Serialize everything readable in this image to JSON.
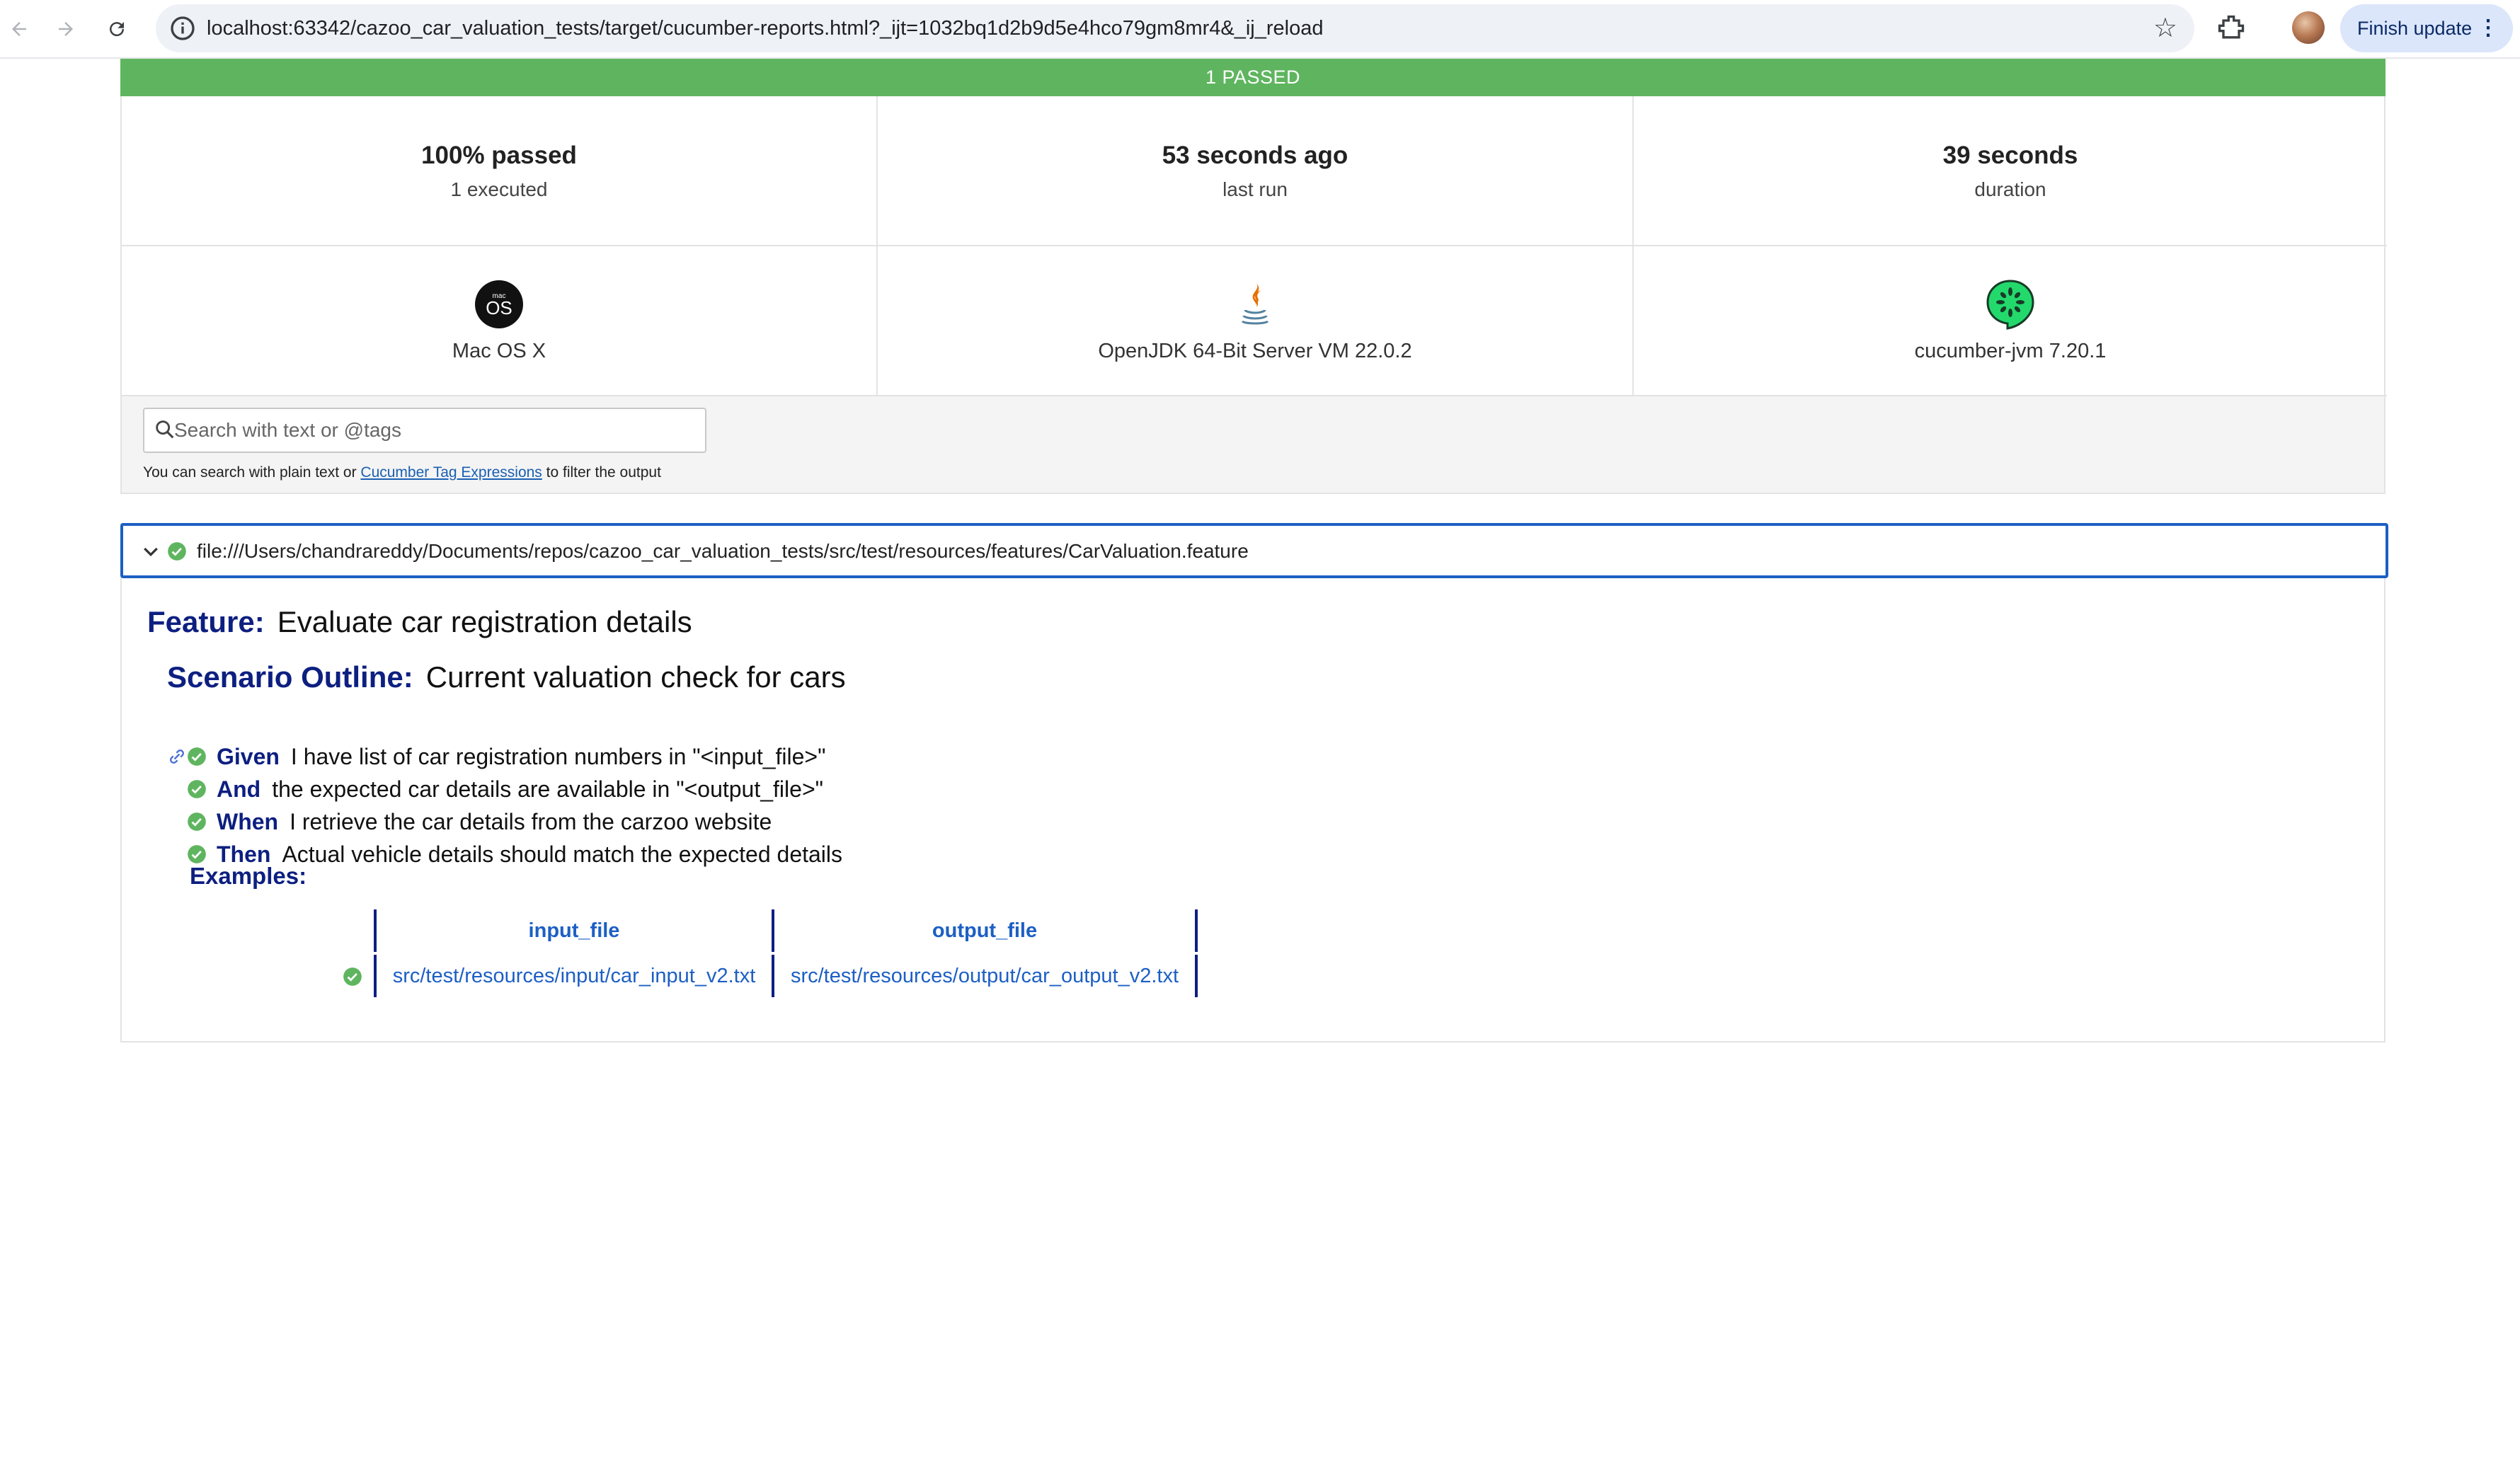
{
  "browser": {
    "url": "localhost:63342/cazoo_car_valuation_tests/target/cucumber-reports.html?_ijt=1032bq1d2b9d5e4hco79gm8mr4&_ij_reload",
    "finish_update_label": "Finish update"
  },
  "summary": {
    "banner": "1 PASSED",
    "stats": [
      {
        "main": "100% passed",
        "sub": "1 executed"
      },
      {
        "main": "53 seconds ago",
        "sub": "last run"
      },
      {
        "main": "39 seconds",
        "sub": "duration"
      }
    ],
    "environment": [
      {
        "icon": "macos-icon",
        "label": "Mac OS X"
      },
      {
        "icon": "java-icon",
        "label": "OpenJDK 64-Bit Server VM 22.0.2"
      },
      {
        "icon": "cucumber-icon",
        "label": "cucumber-jvm 7.20.1"
      }
    ]
  },
  "search": {
    "placeholder": "Search with text or @tags",
    "help_prefix": "You can search with plain text or ",
    "help_link": "Cucumber Tag Expressions",
    "help_suffix": " to filter the output"
  },
  "feature": {
    "uri": "file:///Users/chandrareddy/Documents/repos/cazoo_car_valuation_tests/src/test/resources/features/CarValuation.feature",
    "keyword": "Feature:",
    "name": "Evaluate car registration details",
    "scenario_keyword": "Scenario Outline:",
    "scenario_name": "Current valuation check for cars",
    "steps": [
      {
        "keyword": "Given",
        "text": "I have list of car registration numbers in \"<input_file>\""
      },
      {
        "keyword": "And",
        "text": "the expected car details are available in \"<output_file>\""
      },
      {
        "keyword": "When",
        "text": "I retrieve the car details from the carzoo website"
      },
      {
        "keyword": "Then",
        "text": "Actual vehicle details should match the expected details"
      }
    ],
    "examples_label": "Examples:",
    "examples_headers": [
      "input_file",
      "output_file"
    ],
    "examples_rows": [
      [
        "src/test/resources/input/car_input_v2.txt",
        "src/test/resources/output/car_output_v2.txt"
      ]
    ]
  },
  "colors": {
    "passed": "#5fb55f",
    "keyword": "#0d1f80",
    "link": "#1d5fc4"
  }
}
